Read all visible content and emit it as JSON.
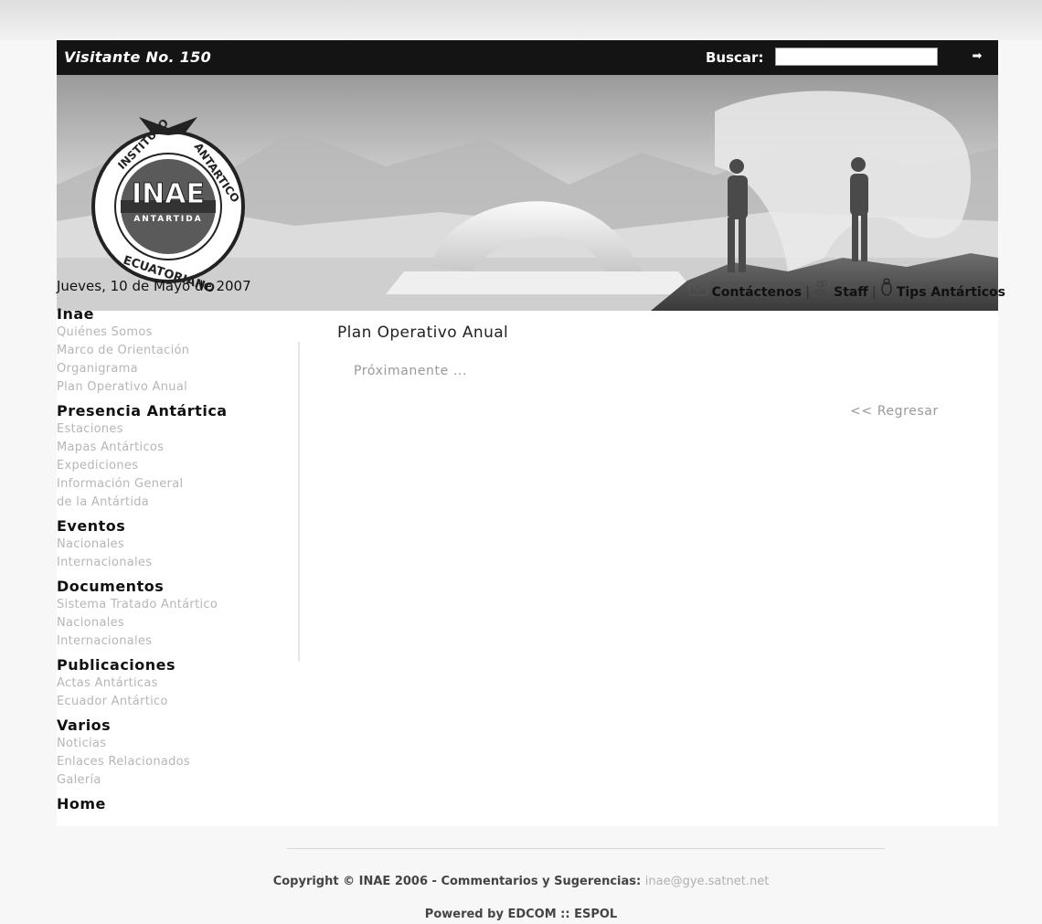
{
  "header": {
    "visitor": "Visitante No. 150",
    "search_label": "Buscar:",
    "search_value": ""
  },
  "logo": {
    "top": "INSTITUTO",
    "right": "ANTARTICO",
    "center": "INAE",
    "band": "ANTARTIDA",
    "bottom": "ECUATORIANO"
  },
  "date": "Jueves, 10 de Mayo de 2007",
  "toplinks": {
    "contact": "Contáctenos",
    "staff": "Staff",
    "tips": "Tips Antárticos",
    "sep": "|"
  },
  "sidebar": [
    {
      "title": "Inae",
      "items": [
        "Quiénes Somos",
        "Marco de Orientación",
        "Organigrama",
        "Plan Operativo Anual"
      ]
    },
    {
      "title": "Presencia Antártica",
      "items": [
        "Estaciones",
        "Mapas Antárticos",
        "Expediciones",
        "Información General",
        "de la Antártida"
      ]
    },
    {
      "title": "Eventos",
      "items": [
        "Nacionales",
        "Internacionales"
      ]
    },
    {
      "title": "Documentos",
      "items": [
        "Sistema Tratado Antártico",
        "Nacionales",
        "Internacionales"
      ]
    },
    {
      "title": "Publicaciones",
      "items": [
        "Actas Antárticas",
        "Ecuador Antártico"
      ]
    },
    {
      "title": "Varios",
      "items": [
        "Noticias",
        "Enlaces Relacionados",
        "Galería"
      ]
    }
  ],
  "home": "Home",
  "content": {
    "title": "Plan Operativo Anual",
    "text": "Próximanente ...",
    "back": "<< Regresar"
  },
  "footer": {
    "copyright": "Copyright © INAE 2006 - Commentarios y Sugerencias:",
    "email": "inae@gye.satnet.net",
    "powered": "Powered by EDCOM :: ESPOL"
  }
}
